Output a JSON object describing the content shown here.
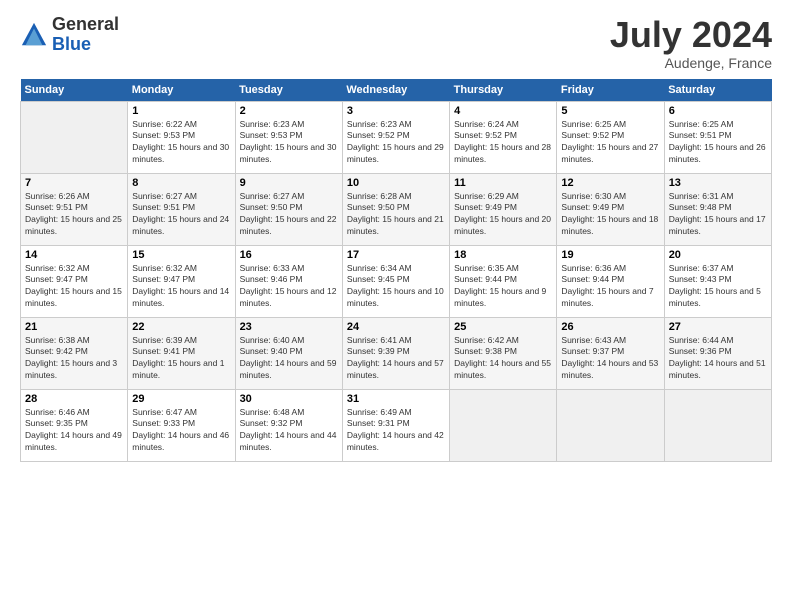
{
  "header": {
    "logo_general": "General",
    "logo_blue": "Blue",
    "month_title": "July 2024",
    "subtitle": "Audenge, France"
  },
  "days_of_week": [
    "Sunday",
    "Monday",
    "Tuesday",
    "Wednesday",
    "Thursday",
    "Friday",
    "Saturday"
  ],
  "weeks": [
    [
      {
        "day": "",
        "empty": true
      },
      {
        "day": "1",
        "sunrise": "Sunrise: 6:22 AM",
        "sunset": "Sunset: 9:53 PM",
        "daylight": "Daylight: 15 hours and 30 minutes."
      },
      {
        "day": "2",
        "sunrise": "Sunrise: 6:23 AM",
        "sunset": "Sunset: 9:53 PM",
        "daylight": "Daylight: 15 hours and 30 minutes."
      },
      {
        "day": "3",
        "sunrise": "Sunrise: 6:23 AM",
        "sunset": "Sunset: 9:52 PM",
        "daylight": "Daylight: 15 hours and 29 minutes."
      },
      {
        "day": "4",
        "sunrise": "Sunrise: 6:24 AM",
        "sunset": "Sunset: 9:52 PM",
        "daylight": "Daylight: 15 hours and 28 minutes."
      },
      {
        "day": "5",
        "sunrise": "Sunrise: 6:25 AM",
        "sunset": "Sunset: 9:52 PM",
        "daylight": "Daylight: 15 hours and 27 minutes."
      },
      {
        "day": "6",
        "sunrise": "Sunrise: 6:25 AM",
        "sunset": "Sunset: 9:51 PM",
        "daylight": "Daylight: 15 hours and 26 minutes."
      }
    ],
    [
      {
        "day": "7",
        "sunrise": "Sunrise: 6:26 AM",
        "sunset": "Sunset: 9:51 PM",
        "daylight": "Daylight: 15 hours and 25 minutes."
      },
      {
        "day": "8",
        "sunrise": "Sunrise: 6:27 AM",
        "sunset": "Sunset: 9:51 PM",
        "daylight": "Daylight: 15 hours and 24 minutes."
      },
      {
        "day": "9",
        "sunrise": "Sunrise: 6:27 AM",
        "sunset": "Sunset: 9:50 PM",
        "daylight": "Daylight: 15 hours and 22 minutes."
      },
      {
        "day": "10",
        "sunrise": "Sunrise: 6:28 AM",
        "sunset": "Sunset: 9:50 PM",
        "daylight": "Daylight: 15 hours and 21 minutes."
      },
      {
        "day": "11",
        "sunrise": "Sunrise: 6:29 AM",
        "sunset": "Sunset: 9:49 PM",
        "daylight": "Daylight: 15 hours and 20 minutes."
      },
      {
        "day": "12",
        "sunrise": "Sunrise: 6:30 AM",
        "sunset": "Sunset: 9:49 PM",
        "daylight": "Daylight: 15 hours and 18 minutes."
      },
      {
        "day": "13",
        "sunrise": "Sunrise: 6:31 AM",
        "sunset": "Sunset: 9:48 PM",
        "daylight": "Daylight: 15 hours and 17 minutes."
      }
    ],
    [
      {
        "day": "14",
        "sunrise": "Sunrise: 6:32 AM",
        "sunset": "Sunset: 9:47 PM",
        "daylight": "Daylight: 15 hours and 15 minutes."
      },
      {
        "day": "15",
        "sunrise": "Sunrise: 6:32 AM",
        "sunset": "Sunset: 9:47 PM",
        "daylight": "Daylight: 15 hours and 14 minutes."
      },
      {
        "day": "16",
        "sunrise": "Sunrise: 6:33 AM",
        "sunset": "Sunset: 9:46 PM",
        "daylight": "Daylight: 15 hours and 12 minutes."
      },
      {
        "day": "17",
        "sunrise": "Sunrise: 6:34 AM",
        "sunset": "Sunset: 9:45 PM",
        "daylight": "Daylight: 15 hours and 10 minutes."
      },
      {
        "day": "18",
        "sunrise": "Sunrise: 6:35 AM",
        "sunset": "Sunset: 9:44 PM",
        "daylight": "Daylight: 15 hours and 9 minutes."
      },
      {
        "day": "19",
        "sunrise": "Sunrise: 6:36 AM",
        "sunset": "Sunset: 9:44 PM",
        "daylight": "Daylight: 15 hours and 7 minutes."
      },
      {
        "day": "20",
        "sunrise": "Sunrise: 6:37 AM",
        "sunset": "Sunset: 9:43 PM",
        "daylight": "Daylight: 15 hours and 5 minutes."
      }
    ],
    [
      {
        "day": "21",
        "sunrise": "Sunrise: 6:38 AM",
        "sunset": "Sunset: 9:42 PM",
        "daylight": "Daylight: 15 hours and 3 minutes."
      },
      {
        "day": "22",
        "sunrise": "Sunrise: 6:39 AM",
        "sunset": "Sunset: 9:41 PM",
        "daylight": "Daylight: 15 hours and 1 minute."
      },
      {
        "day": "23",
        "sunrise": "Sunrise: 6:40 AM",
        "sunset": "Sunset: 9:40 PM",
        "daylight": "Daylight: 14 hours and 59 minutes."
      },
      {
        "day": "24",
        "sunrise": "Sunrise: 6:41 AM",
        "sunset": "Sunset: 9:39 PM",
        "daylight": "Daylight: 14 hours and 57 minutes."
      },
      {
        "day": "25",
        "sunrise": "Sunrise: 6:42 AM",
        "sunset": "Sunset: 9:38 PM",
        "daylight": "Daylight: 14 hours and 55 minutes."
      },
      {
        "day": "26",
        "sunrise": "Sunrise: 6:43 AM",
        "sunset": "Sunset: 9:37 PM",
        "daylight": "Daylight: 14 hours and 53 minutes."
      },
      {
        "day": "27",
        "sunrise": "Sunrise: 6:44 AM",
        "sunset": "Sunset: 9:36 PM",
        "daylight": "Daylight: 14 hours and 51 minutes."
      }
    ],
    [
      {
        "day": "28",
        "sunrise": "Sunrise: 6:46 AM",
        "sunset": "Sunset: 9:35 PM",
        "daylight": "Daylight: 14 hours and 49 minutes."
      },
      {
        "day": "29",
        "sunrise": "Sunrise: 6:47 AM",
        "sunset": "Sunset: 9:33 PM",
        "daylight": "Daylight: 14 hours and 46 minutes."
      },
      {
        "day": "30",
        "sunrise": "Sunrise: 6:48 AM",
        "sunset": "Sunset: 9:32 PM",
        "daylight": "Daylight: 14 hours and 44 minutes."
      },
      {
        "day": "31",
        "sunrise": "Sunrise: 6:49 AM",
        "sunset": "Sunset: 9:31 PM",
        "daylight": "Daylight: 14 hours and 42 minutes."
      },
      {
        "day": "",
        "empty": true
      },
      {
        "day": "",
        "empty": true
      },
      {
        "day": "",
        "empty": true
      }
    ]
  ]
}
